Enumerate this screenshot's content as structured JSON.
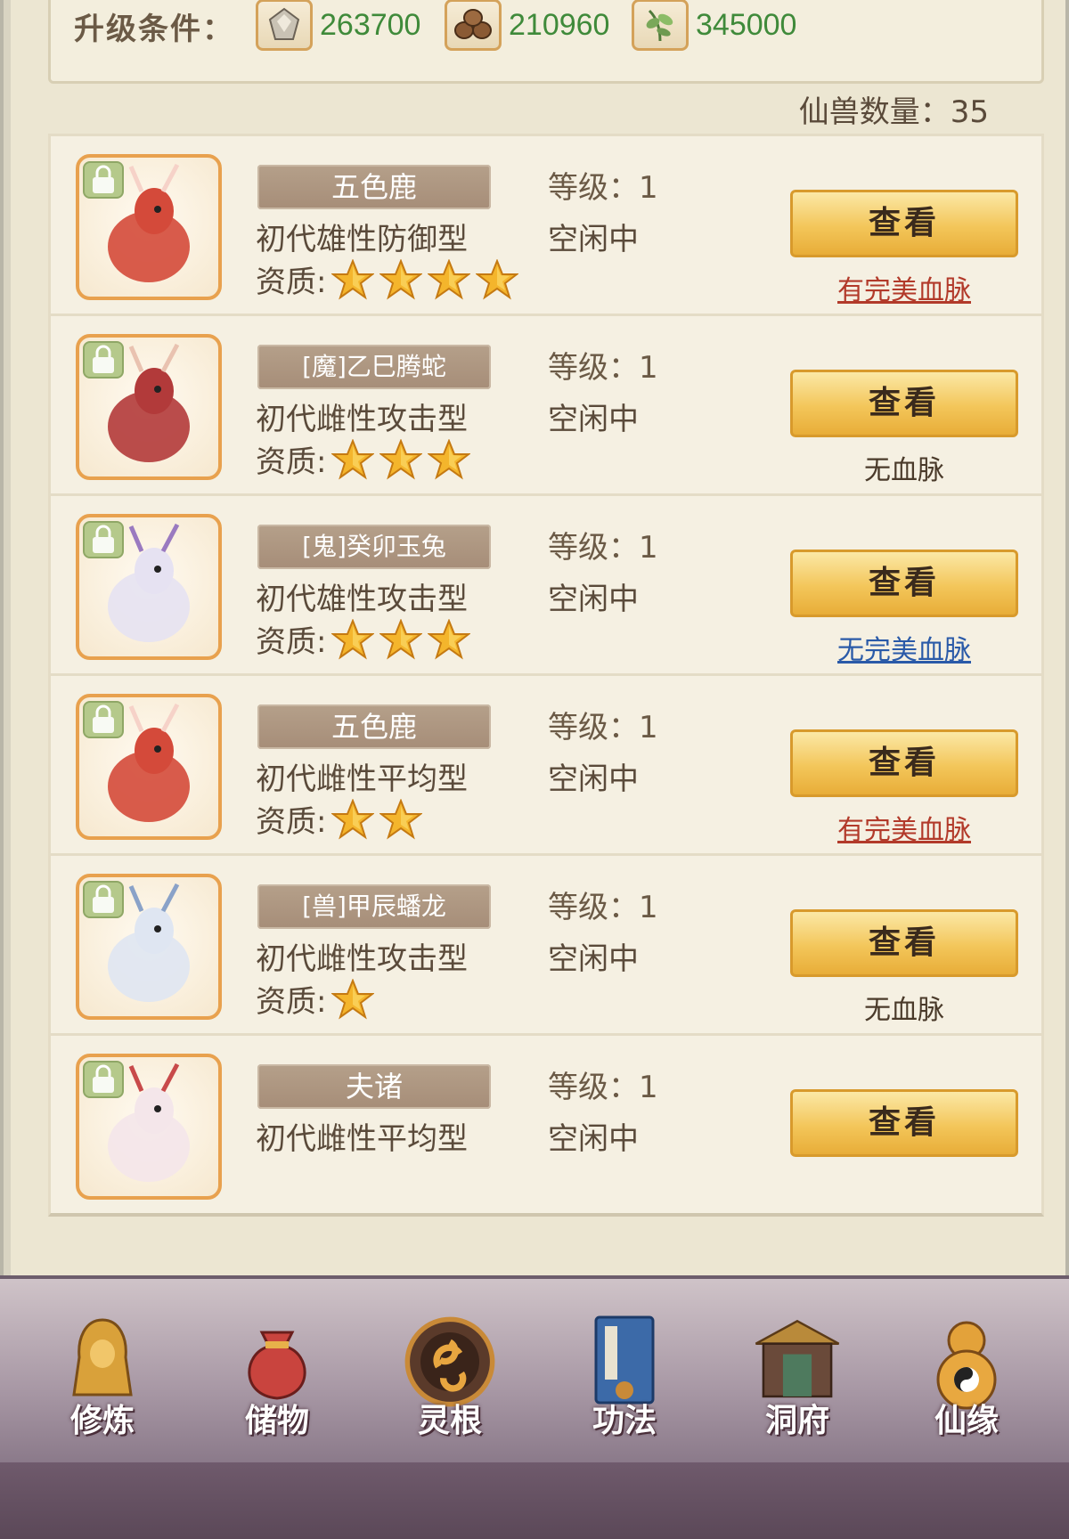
{
  "upgrade": {
    "label": "升级条件：",
    "resources": [
      {
        "icon": "crystal-ore-icon",
        "value": "263700"
      },
      {
        "icon": "wood-logs-icon",
        "value": "210960"
      },
      {
        "icon": "herb-leaf-icon",
        "value": "345000"
      }
    ]
  },
  "beast_count": "仙兽数量：35",
  "beasts": [
    {
      "name": "五色鹿",
      "type": "初代雄性防御型",
      "quality_label": "资质:",
      "stars": 4,
      "level": "等级：1",
      "status": "空闲中",
      "button": "查看",
      "bloodline": "有完美血脉",
      "bloodline_kind": "perfect",
      "portrait": "deer-portrait"
    },
    {
      "name": "[魔]乙巳腾蛇",
      "type": "初代雌性攻击型",
      "quality_label": "资质:",
      "stars": 3,
      "level": "等级：1",
      "status": "空闲中",
      "button": "查看",
      "bloodline": "无血脉",
      "bloodline_kind": "none",
      "portrait": "serpent-portrait"
    },
    {
      "name": "[鬼]癸卯玉兔",
      "type": "初代雄性攻击型",
      "quality_label": "资质:",
      "stars": 3,
      "level": "等级：1",
      "status": "空闲中",
      "button": "查看",
      "bloodline": "无完美血脉",
      "bloodline_kind": "noperfect",
      "portrait": "rabbit-portrait"
    },
    {
      "name": "五色鹿",
      "type": "初代雌性平均型",
      "quality_label": "资质:",
      "stars": 2,
      "level": "等级：1",
      "status": "空闲中",
      "button": "查看",
      "bloodline": "有完美血脉",
      "bloodline_kind": "perfect",
      "portrait": "deer-portrait"
    },
    {
      "name": "[兽]甲辰蟠龙",
      "type": "初代雌性攻击型",
      "quality_label": "资质:",
      "stars": 1,
      "level": "等级：1",
      "status": "空闲中",
      "button": "查看",
      "bloodline": "无血脉",
      "bloodline_kind": "none",
      "portrait": "dragon-portrait"
    },
    {
      "name": "夫诸",
      "type": "初代雌性平均型",
      "quality_label": "",
      "stars": 0,
      "level": "等级：1",
      "status": "空闲中",
      "button": "查看",
      "bloodline": "",
      "bloodline_kind": "none",
      "portrait": "fuzhu-portrait"
    }
  ],
  "nav": [
    {
      "label": "修炼",
      "icon": "meditating-monk-icon"
    },
    {
      "label": "储物",
      "icon": "storage-bag-icon"
    },
    {
      "label": "灵根",
      "icon": "spirit-root-icon"
    },
    {
      "label": "功法",
      "icon": "scripture-book-icon"
    },
    {
      "label": "洞府",
      "icon": "cave-mansion-icon"
    },
    {
      "label": "仙缘",
      "icon": "gourd-taiji-icon"
    }
  ],
  "colors": {
    "panel_bg": "#ece6d2",
    "card_bg": "#f5f0e2",
    "resource_green": "#3f8a3a",
    "perfect_red": "#b23a2a",
    "noperfect_blue": "#2a5aa8",
    "button_gold": "#f3c65a"
  }
}
